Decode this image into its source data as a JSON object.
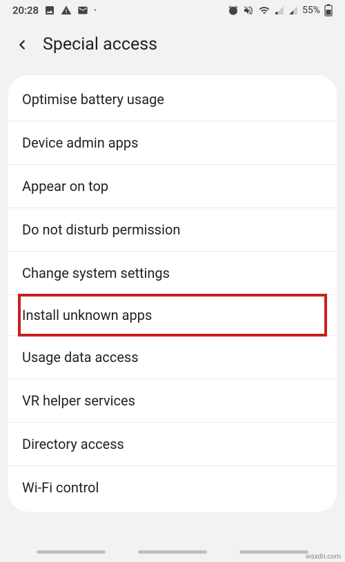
{
  "statusbar": {
    "time": "20:28",
    "battery_text": "55%"
  },
  "header": {
    "title": "Special access"
  },
  "items": [
    {
      "label": "Optimise battery usage"
    },
    {
      "label": "Device admin apps"
    },
    {
      "label": "Appear on top"
    },
    {
      "label": "Do not disturb permission"
    },
    {
      "label": "Change system settings"
    },
    {
      "label": "Install unknown apps",
      "highlighted": true
    },
    {
      "label": "Usage data access"
    },
    {
      "label": "VR helper services"
    },
    {
      "label": "Directory access"
    },
    {
      "label": "Wi-Fi control"
    }
  ],
  "watermark": "wsxdn.com"
}
